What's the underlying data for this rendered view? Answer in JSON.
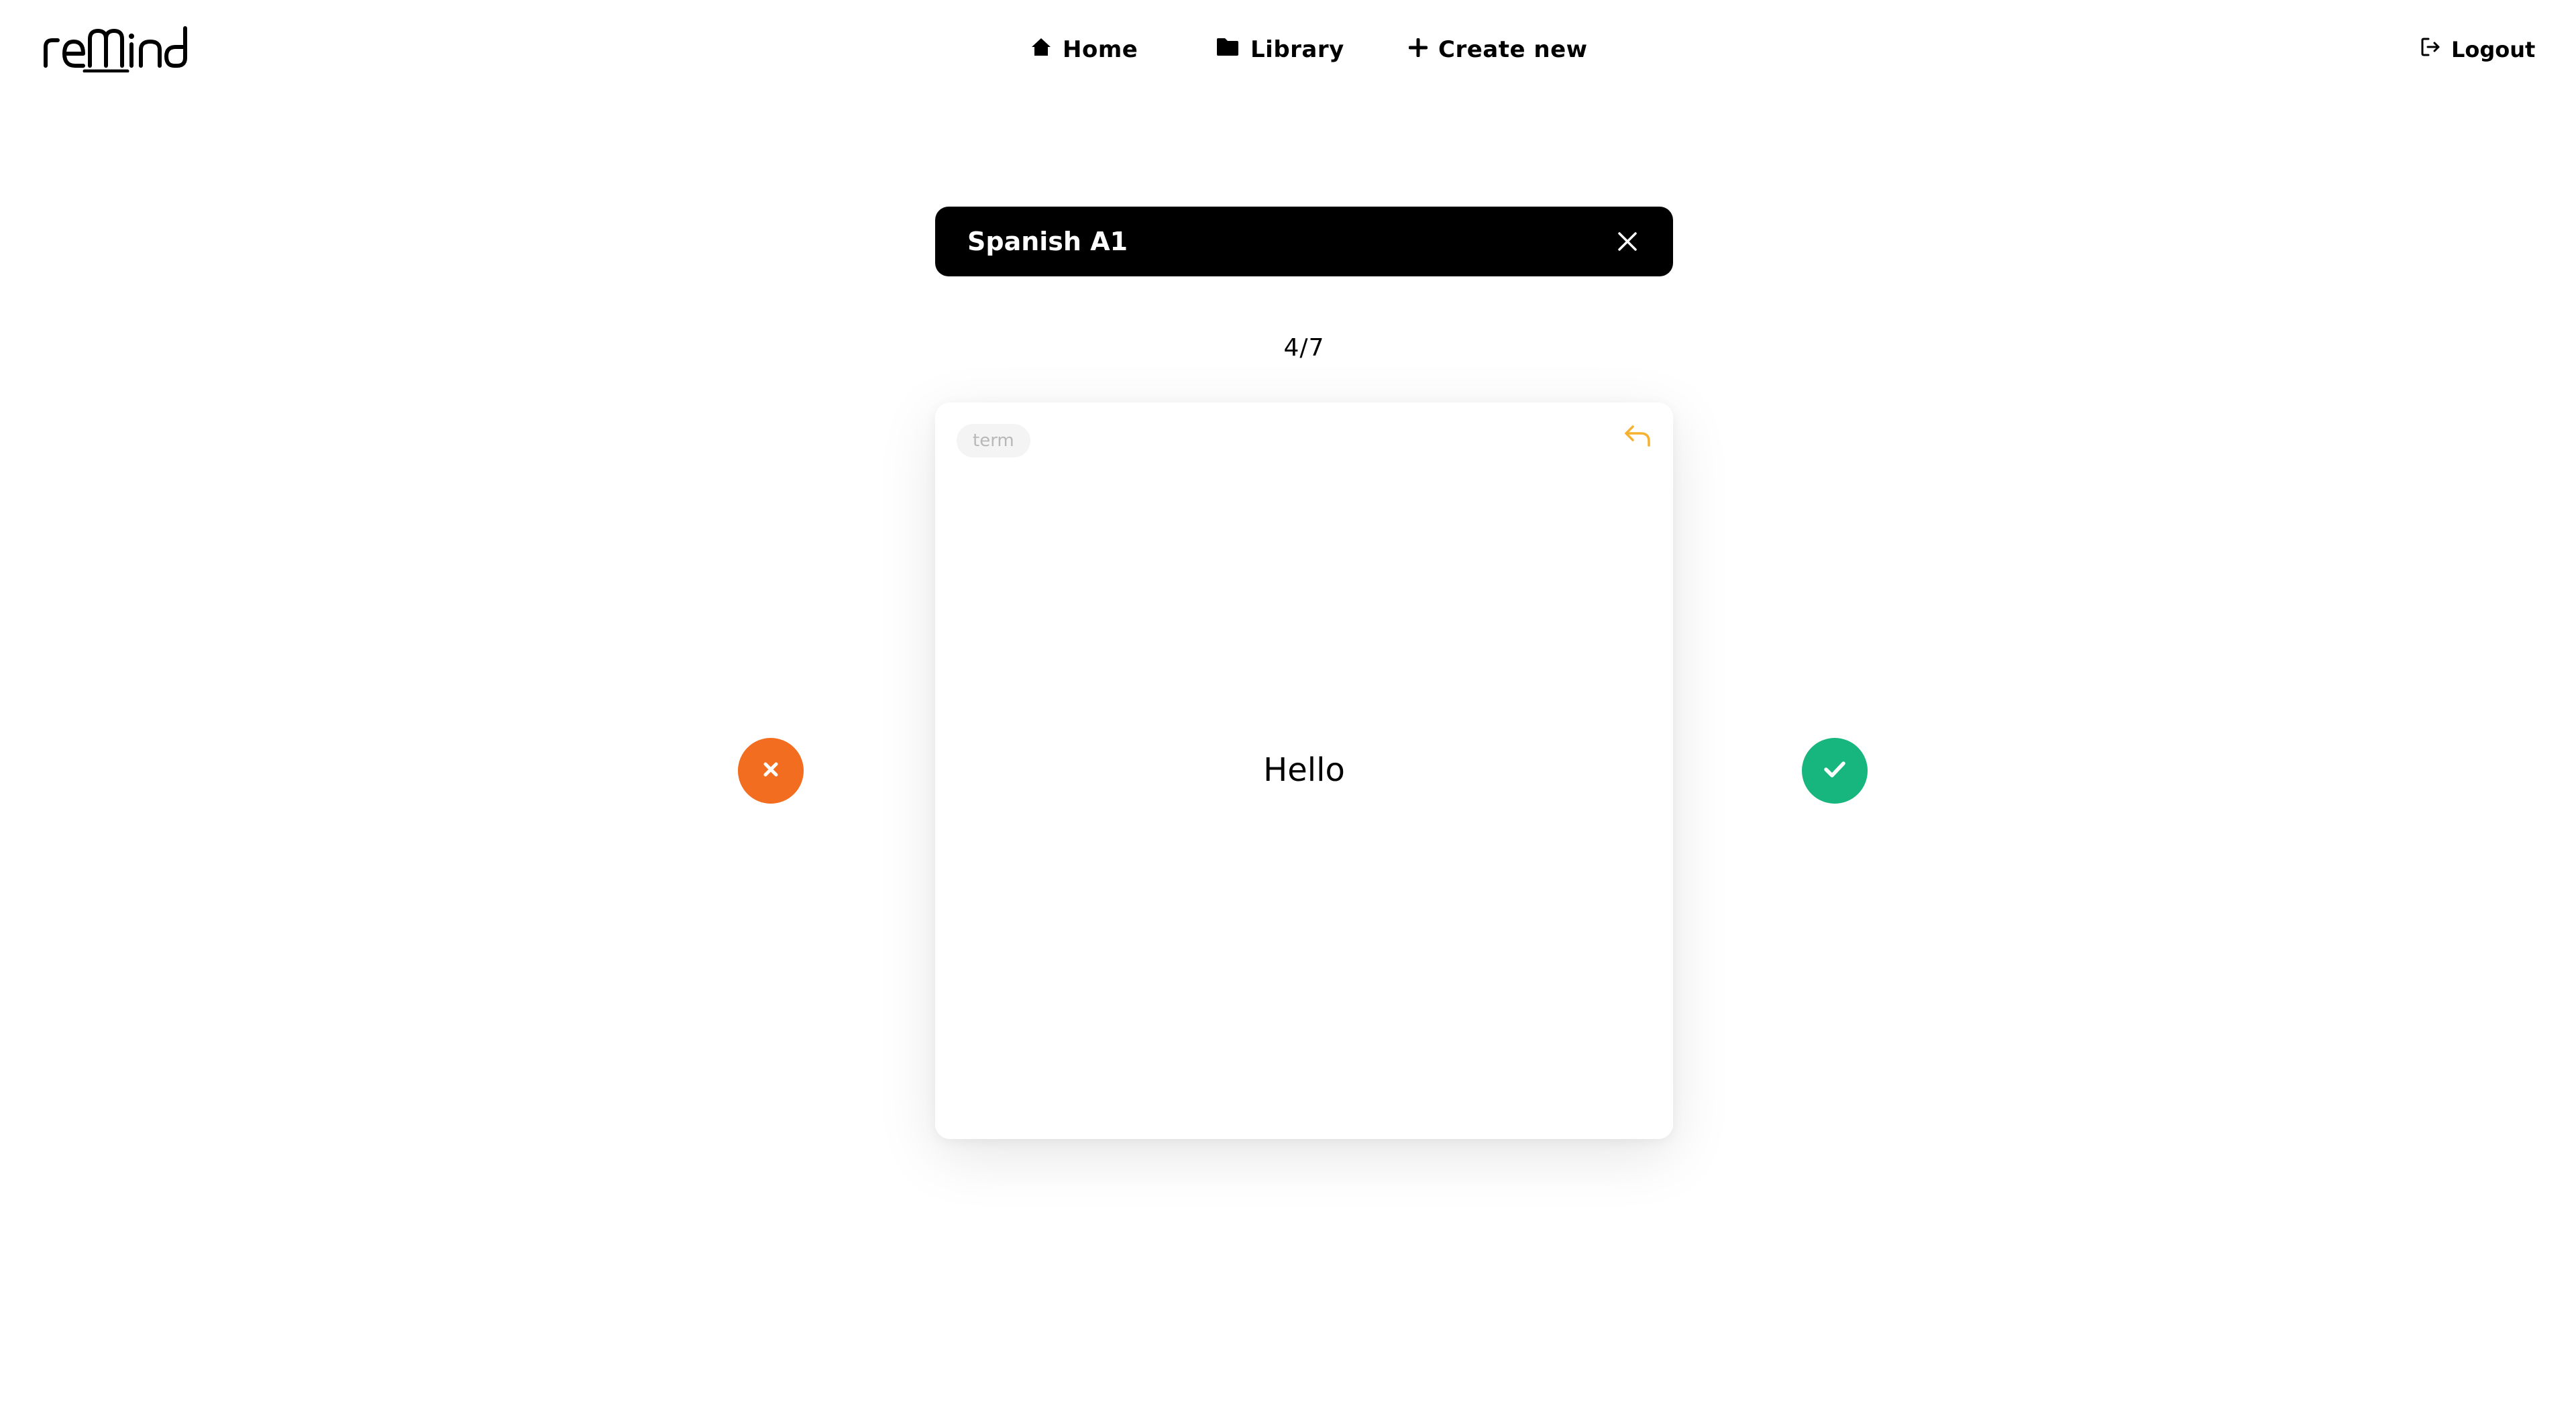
{
  "app": {
    "logo_text": "reMind"
  },
  "nav": {
    "home": "Home",
    "library": "Library",
    "create_new": "Create new",
    "logout": "Logout"
  },
  "deck": {
    "title": "Spanish A1"
  },
  "progress": {
    "text": "4/7",
    "current": 4,
    "total": 7
  },
  "card": {
    "badge": "term",
    "text": "Hello"
  },
  "colors": {
    "wrong": "#f26d1f",
    "correct": "#17b67e",
    "flip_accent": "#f5b12f"
  },
  "icons": {
    "home": "home-icon",
    "library": "folder-icon",
    "create": "plus-icon",
    "logout": "logout-icon",
    "close": "close-icon",
    "flip": "undo-arrow-icon",
    "wrong": "x-icon",
    "correct": "check-icon"
  }
}
